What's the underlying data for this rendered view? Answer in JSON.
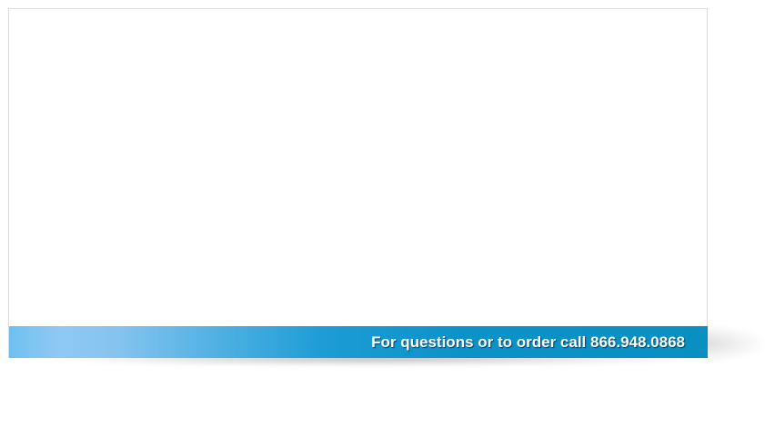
{
  "banner": {
    "text": "For questions or to order call 866.948.0868",
    "gradient_start": "#8fc8f5",
    "gradient_end": "#0a8fc2"
  }
}
